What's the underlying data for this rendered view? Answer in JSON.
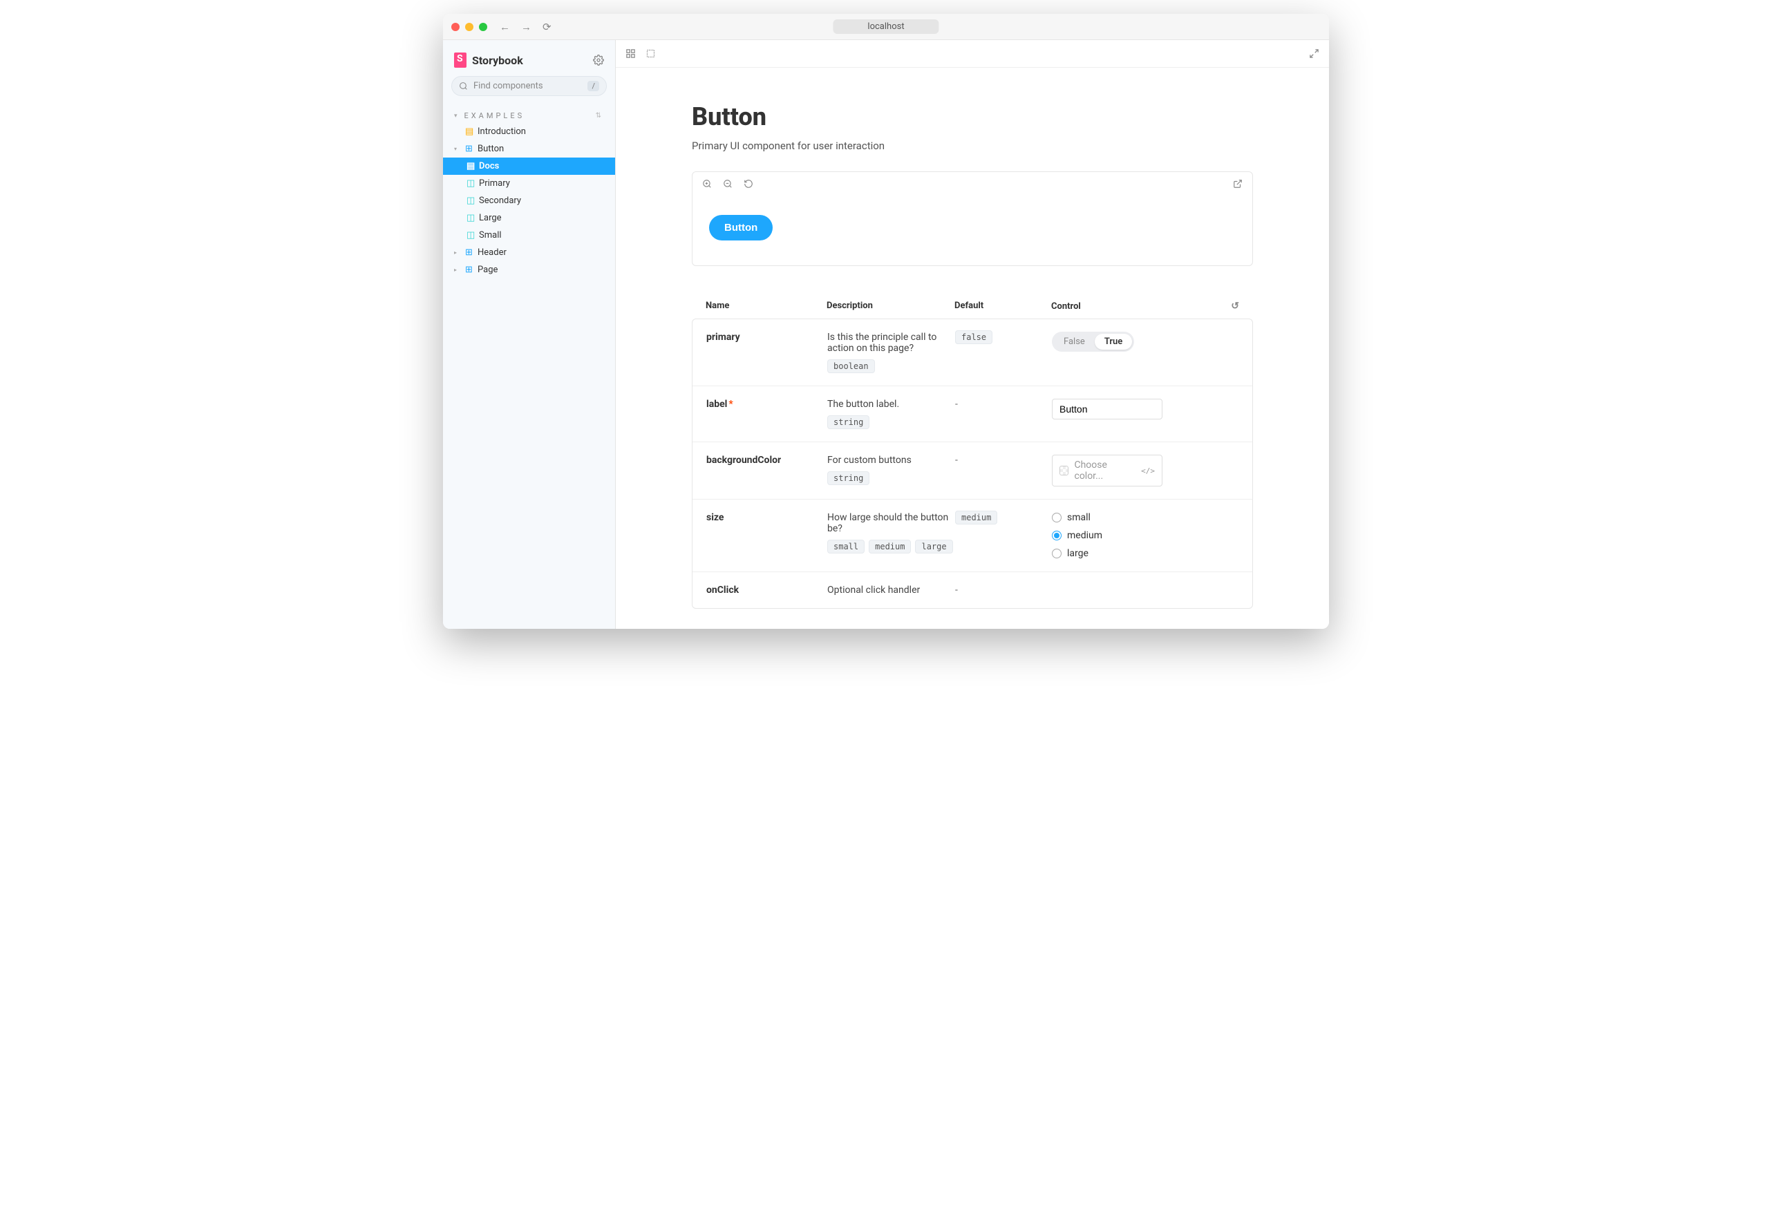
{
  "titlebar": {
    "url": "localhost"
  },
  "sidebar": {
    "brand": "Storybook",
    "searchPlaceholder": "Find components",
    "shortcut": "/",
    "sectionLabel": "EXAMPLES",
    "items": [
      {
        "label": "Introduction",
        "type": "doc"
      },
      {
        "label": "Button",
        "type": "component",
        "expanded": true,
        "children": [
          {
            "label": "Docs",
            "type": "page",
            "selected": true
          },
          {
            "label": "Primary",
            "type": "story"
          },
          {
            "label": "Secondary",
            "type": "story"
          },
          {
            "label": "Large",
            "type": "story"
          },
          {
            "label": "Small",
            "type": "story"
          }
        ]
      },
      {
        "label": "Header",
        "type": "component"
      },
      {
        "label": "Page",
        "type": "component"
      }
    ]
  },
  "doc": {
    "title": "Button",
    "subtitle": "Primary UI component for user interaction",
    "demoLabel": "Button",
    "argsHeader": {
      "name": "Name",
      "desc": "Description",
      "def": "Default",
      "ctl": "Control"
    },
    "rows": [
      {
        "name": "primary",
        "desc": "Is this the principle call to action on this page?",
        "types": [
          "boolean"
        ],
        "def": "false",
        "control": {
          "kind": "toggle",
          "falseLabel": "False",
          "trueLabel": "True",
          "value": true
        }
      },
      {
        "name": "label",
        "required": true,
        "desc": "The button label.",
        "types": [
          "string"
        ],
        "def": "-",
        "control": {
          "kind": "text",
          "value": "Button"
        }
      },
      {
        "name": "backgroundColor",
        "desc": "For custom buttons",
        "types": [
          "string"
        ],
        "def": "-",
        "control": {
          "kind": "color",
          "placeholder": "Choose color..."
        }
      },
      {
        "name": "size",
        "desc": "How large should the button be?",
        "types": [
          "small",
          "medium",
          "large"
        ],
        "def": "medium",
        "control": {
          "kind": "radio",
          "options": [
            "small",
            "medium",
            "large"
          ],
          "value": "medium"
        }
      },
      {
        "name": "onClick",
        "desc": "Optional click handler",
        "types": [],
        "def": "-",
        "control": {
          "kind": "none"
        }
      }
    ]
  }
}
